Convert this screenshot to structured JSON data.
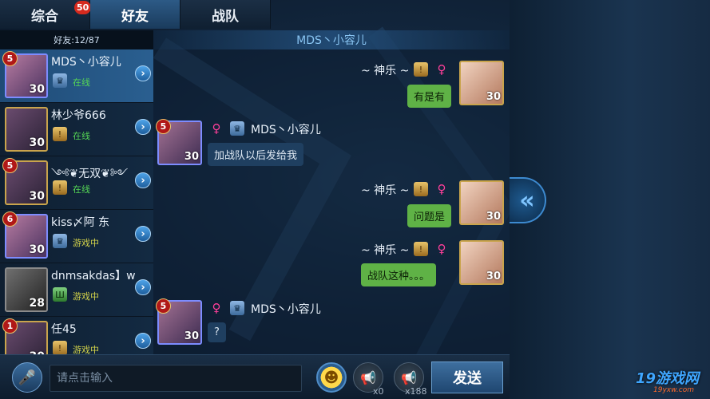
{
  "tabs": [
    {
      "label": "综合",
      "badge": "50",
      "active": false
    },
    {
      "label": "好友",
      "active": true
    },
    {
      "label": "战队",
      "active": false
    }
  ],
  "friends": {
    "header": "好友:12/87",
    "items": [
      {
        "name": "MDS丶小容儿",
        "rank": "5",
        "level": "30",
        "tier": "blue",
        "status": "在线"
      },
      {
        "name": "林少爷666",
        "rank": "",
        "level": "30",
        "tier": "gold",
        "status": "在线"
      },
      {
        "name": "༺❦无双❦༻",
        "rank": "5",
        "level": "30",
        "tier": "gold",
        "status": "在线"
      },
      {
        "name": "kiss〆阿 东",
        "rank": "6",
        "level": "30",
        "tier": "blue",
        "status": "游戏中"
      },
      {
        "name": "dnmsakdas】w",
        "rank": "",
        "level": "28",
        "tier": "green",
        "status": "游戏中"
      },
      {
        "name": "任45",
        "rank": "1",
        "level": "30",
        "tier": "gold",
        "status": "游戏中"
      }
    ]
  },
  "chat": {
    "title": "MDS丶小容儿",
    "messages": [
      {
        "side": "me",
        "name": "~ 神乐 ~",
        "text": "有是有",
        "level": "30"
      },
      {
        "side": "them",
        "name": "MDS丶小容儿",
        "text": "加战队以后发给我",
        "level": "30",
        "rank": "5"
      },
      {
        "side": "me",
        "name": "~ 神乐 ~",
        "text": "问题是",
        "level": "30"
      },
      {
        "side": "me",
        "name": "~ 神乐 ~",
        "text": "战队这种。。。",
        "level": "30"
      },
      {
        "side": "them",
        "name": "MDS丶小容儿",
        "text": "?",
        "level": "30",
        "rank": "5"
      }
    ],
    "gender_symbol": "♀",
    "tier_symbol": "!"
  },
  "bottom": {
    "input_placeholder": "请点击输入",
    "horn1_count": "x0",
    "horn2_count": "x188",
    "send_label": "发送"
  },
  "toggle_icon": "«",
  "watermark": {
    "main": "19游戏网",
    "sub": "19yxw.com"
  },
  "colors": {
    "accent": "#2a5f90",
    "online": "#55d655",
    "ingame": "#d2d24a",
    "my_bubble": "#5fb246",
    "badge": "#d62a1e"
  }
}
